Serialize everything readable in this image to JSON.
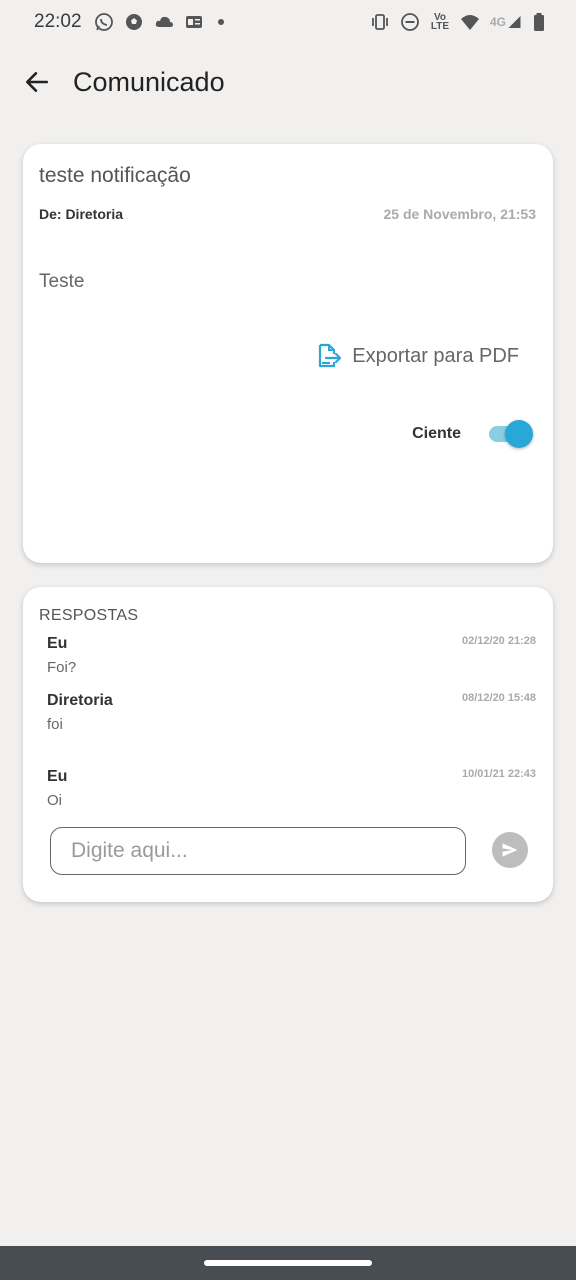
{
  "status_bar": {
    "time": "22:02",
    "left_icons": [
      "whatsapp-icon",
      "soccer-ball-icon",
      "cloud-icon",
      "news-icon"
    ],
    "right_icons": [
      "vibrate-icon",
      "do-not-disturb-icon",
      "volte-icon",
      "wifi-icon",
      "signal-icon",
      "battery-icon"
    ],
    "volte_label": "Vo LTE",
    "network_label": "4G"
  },
  "app_bar": {
    "title": "Comunicado",
    "back_icon": "arrow-left-icon"
  },
  "notice": {
    "title": "teste notificação",
    "from": "De: Diretoria",
    "date": "25 de Novembro, 21:53",
    "body": "Teste",
    "export_label": "Exportar para PDF",
    "export_icon": "pdf-export-icon",
    "ciente_label": "Ciente",
    "ciente_on": true,
    "accent_color": "#29a8d8"
  },
  "replies": {
    "heading": "RESPOSTAS",
    "items": [
      {
        "author": "Eu",
        "time": "02/12/20 21:28",
        "text": "Foi?"
      },
      {
        "author": "Diretoria",
        "time": "08/12/20 15:48",
        "text": "foi"
      },
      {
        "author": "Eu",
        "time": "10/01/21 22:43",
        "text": "Oi"
      }
    ],
    "input_placeholder": "Digite aqui...",
    "input_value": "",
    "send_icon": "send-icon"
  }
}
